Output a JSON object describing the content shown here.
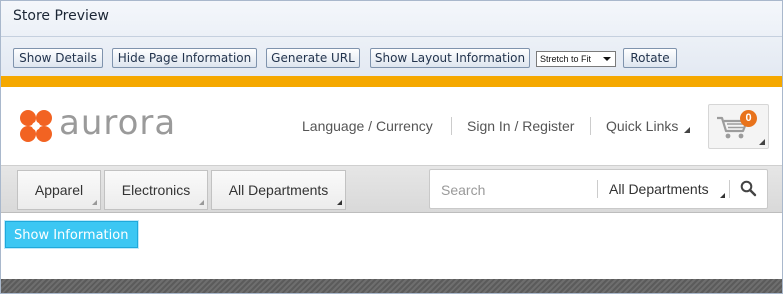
{
  "preview": {
    "title": "Store Preview",
    "toolbar": {
      "show_details": "Show Details",
      "hide_page_info": "Hide Page Information",
      "generate_url": "Generate URL",
      "show_layout_info": "Show Layout Information",
      "fit_select_value": "Stretch to Fit",
      "rotate": "Rotate"
    }
  },
  "store": {
    "logo_text": "aurora",
    "header_links": {
      "language_currency": "Language / Currency",
      "sign_in": "Sign In / Register",
      "quick_links": "Quick Links"
    },
    "cart_count": "0",
    "nav": {
      "apparel": "Apparel",
      "electronics": "Electronics",
      "all_departments": "All Departments"
    },
    "search": {
      "placeholder": "Search",
      "category": "All Departments"
    },
    "show_information": "Show Information"
  },
  "colors": {
    "accent_bar": "#f5a800",
    "logo_mark": "#f26322",
    "cart_badge": "#e8731c",
    "show_info_button": "#3cc7f3"
  },
  "icons": [
    "aurora-logo-mark",
    "cart-icon",
    "search-icon",
    "corner-dropdown-icon",
    "select-arrow-icon"
  ]
}
